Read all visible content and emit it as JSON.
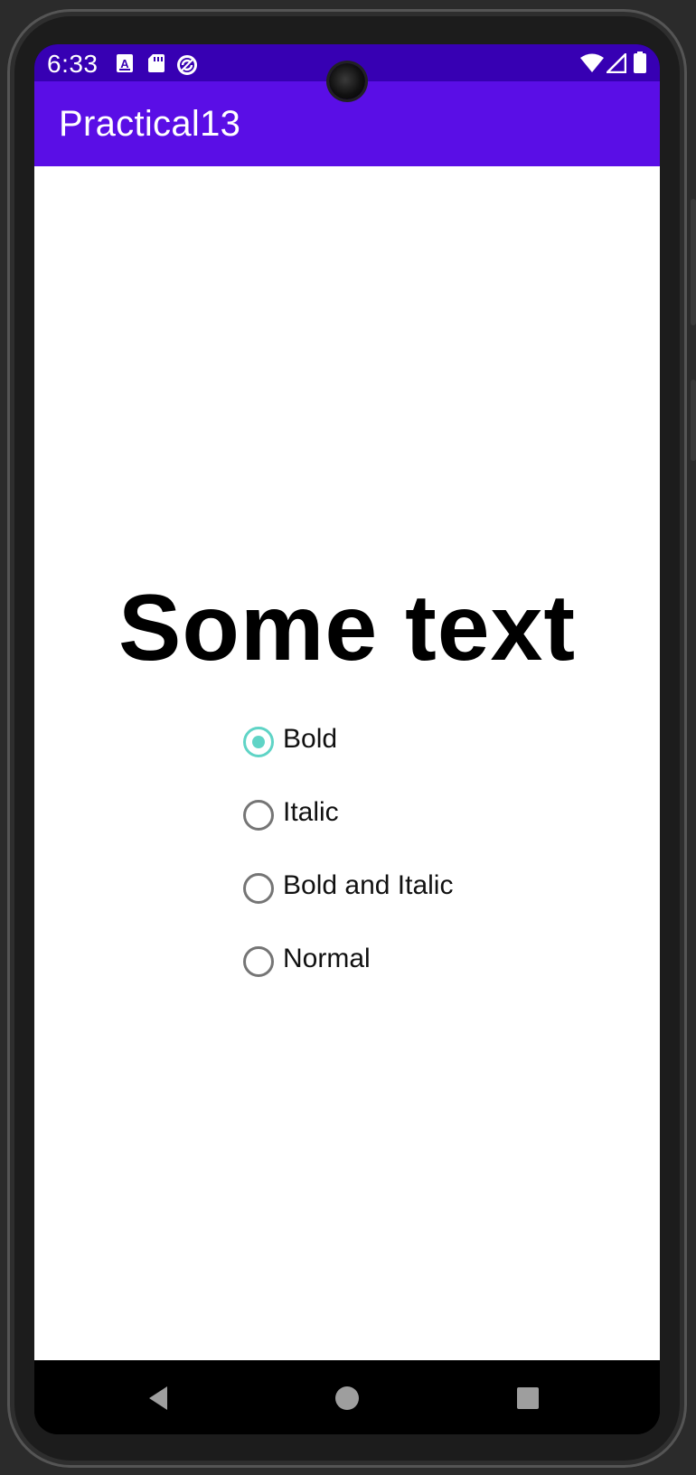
{
  "status_bar": {
    "time": "6:33",
    "left_icons": [
      "text-notification-icon",
      "sd-card-icon",
      "sync-icon"
    ],
    "right_icons": [
      "wifi-icon",
      "signal-icon",
      "battery-icon"
    ]
  },
  "app_bar": {
    "title": "Practical13",
    "color": "#5a0ee6"
  },
  "main": {
    "display_text": "Some text",
    "radio_options": [
      {
        "label": "Bold",
        "checked": true
      },
      {
        "label": "Italic",
        "checked": false
      },
      {
        "label": "Bold and Italic",
        "checked": false
      },
      {
        "label": "Normal",
        "checked": false
      }
    ],
    "accent_color": "#5fd4c6"
  },
  "nav_bar": {
    "buttons": [
      "back-icon",
      "home-icon",
      "recents-icon"
    ]
  }
}
